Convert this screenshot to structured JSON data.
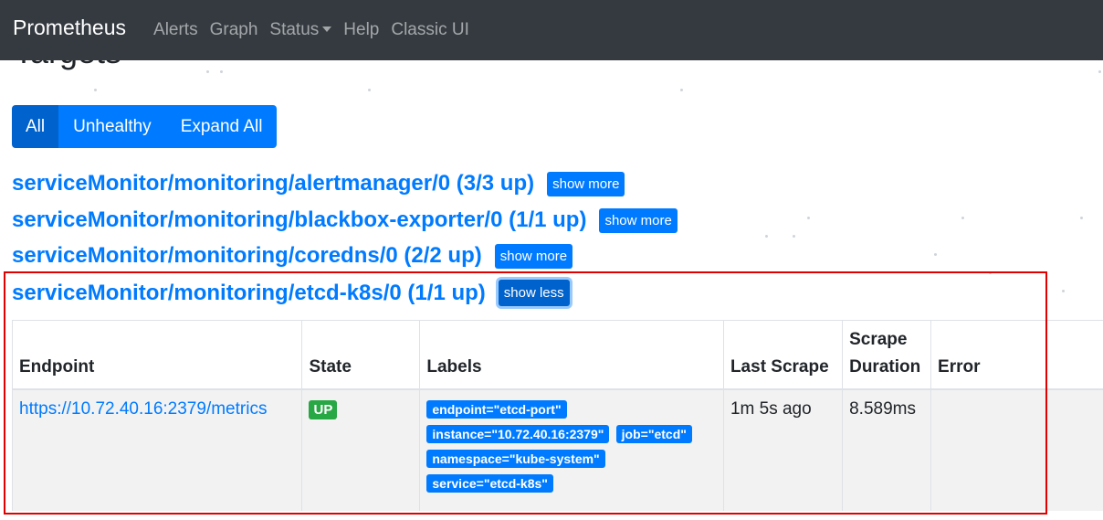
{
  "navbar": {
    "brand": "Prometheus",
    "links": [
      "Alerts",
      "Graph",
      "Status",
      "Help",
      "Classic UI"
    ]
  },
  "page": {
    "title": "Targets"
  },
  "filters": {
    "all": "All",
    "unhealthy": "Unhealthy",
    "expand": "Expand All"
  },
  "pools": [
    {
      "title": "serviceMonitor/monitoring/alertmanager/0 (3/3 up)",
      "toggle": "show more"
    },
    {
      "title": "serviceMonitor/monitoring/blackbox-exporter/0 (1/1 up)",
      "toggle": "show more"
    },
    {
      "title": "serviceMonitor/monitoring/coredns/0 (2/2 up)",
      "toggle": "show more"
    },
    {
      "title": "serviceMonitor/monitoring/etcd-k8s/0 (1/1 up)",
      "toggle": "show less"
    }
  ],
  "table": {
    "headers": {
      "endpoint": "Endpoint",
      "state": "State",
      "labels": "Labels",
      "last_scrape": "Last Scrape",
      "scrape_duration_1": "Scrape",
      "scrape_duration_2": "Duration",
      "error": "Error"
    },
    "row": {
      "endpoint": "https://10.72.40.16:2379/metrics",
      "state": "UP",
      "labels": [
        "endpoint=\"etcd-port\"",
        "instance=\"10.72.40.16:2379\"",
        "job=\"etcd\"",
        "namespace=\"kube-system\"",
        "service=\"etcd-k8s\""
      ],
      "last_scrape": "1m 5s ago",
      "scrape_duration": "8.589ms",
      "error": ""
    }
  },
  "colors": {
    "navbar": "#343a40",
    "primary": "#007bff",
    "success": "#28a745",
    "highlight": "#e00000"
  }
}
